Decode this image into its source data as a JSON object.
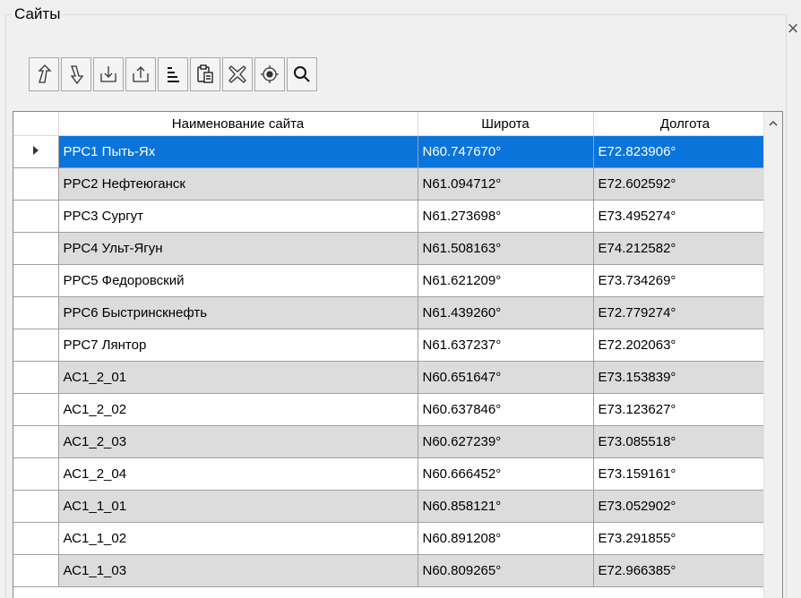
{
  "panel": {
    "title": "Сайты",
    "close_glyph": "×"
  },
  "toolbar": {
    "buttons": [
      {
        "name": "move-up-icon"
      },
      {
        "name": "move-down-icon"
      },
      {
        "name": "import-icon"
      },
      {
        "name": "export-icon"
      },
      {
        "name": "sort-icon"
      },
      {
        "name": "paste-icon"
      },
      {
        "name": "delete-icon"
      },
      {
        "name": "locate-icon"
      },
      {
        "name": "search-icon"
      }
    ]
  },
  "grid": {
    "columns": [
      "Наименование сайта",
      "Широта",
      "Долгота"
    ],
    "rows": [
      {
        "name": "РРС1 Пыть-Ях",
        "lat": "N60.747670°",
        "lon": "E72.823906°"
      },
      {
        "name": "РРС2 Нефтеюганск",
        "lat": "N61.094712°",
        "lon": "E72.602592°"
      },
      {
        "name": "РРС3 Сургут",
        "lat": "N61.273698°",
        "lon": "E73.495274°"
      },
      {
        "name": "РРС4 Ульт-Ягун",
        "lat": "N61.508163°",
        "lon": "E74.212582°"
      },
      {
        "name": "РРС5 Федоровский",
        "lat": "N61.621209°",
        "lon": "E73.734269°"
      },
      {
        "name": "РРС6 Быстринскнефть",
        "lat": "N61.439260°",
        "lon": "E72.779274°"
      },
      {
        "name": "РРС7 Лянтор",
        "lat": "N61.637237°",
        "lon": "E72.202063°"
      },
      {
        "name": "АС1_2_01",
        "lat": "N60.651647°",
        "lon": "E73.153839°"
      },
      {
        "name": "АС1_2_02",
        "lat": "N60.637846°",
        "lon": "E73.123627°"
      },
      {
        "name": "АС1_2_03",
        "lat": "N60.627239°",
        "lon": "E73.085518°"
      },
      {
        "name": "АС1_2_04",
        "lat": "N60.666452°",
        "lon": "E73.159161°"
      },
      {
        "name": "АС1_1_01",
        "lat": "N60.858121°",
        "lon": "E73.052902°"
      },
      {
        "name": "АС1_1_02",
        "lat": "N60.891208°",
        "lon": "E73.291855°"
      },
      {
        "name": "АС1_1_03",
        "lat": "N60.809265°",
        "lon": "E72.966385°"
      }
    ],
    "selected_index": 0
  },
  "colors": {
    "selection": "#0a74da",
    "alt_row": "#dcdcdc"
  }
}
